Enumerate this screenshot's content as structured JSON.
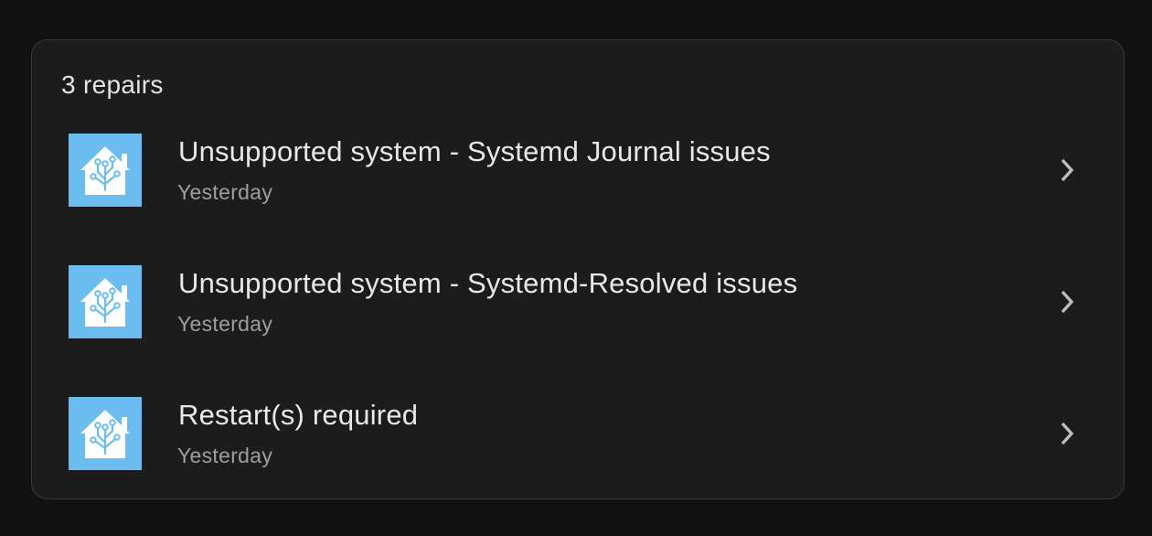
{
  "card": {
    "header": "3 repairs"
  },
  "repairs": [
    {
      "icon": "home-assistant-icon",
      "title": "Unsupported system - Systemd Journal issues",
      "subtitle": "Yesterday"
    },
    {
      "icon": "home-assistant-icon",
      "title": "Unsupported system - Systemd-Resolved issues",
      "subtitle": "Yesterday"
    },
    {
      "icon": "home-assistant-icon",
      "title": "Restart(s) required",
      "subtitle": "Yesterday"
    }
  ],
  "colors": {
    "background": "#111111",
    "card": "#1c1c1c",
    "card_border": "#3a3a3a",
    "icon_background": "#6bbdef",
    "title_text": "#e8e8e8",
    "subtitle_text": "#9e9e9e",
    "chevron": "#bdbdbd"
  }
}
